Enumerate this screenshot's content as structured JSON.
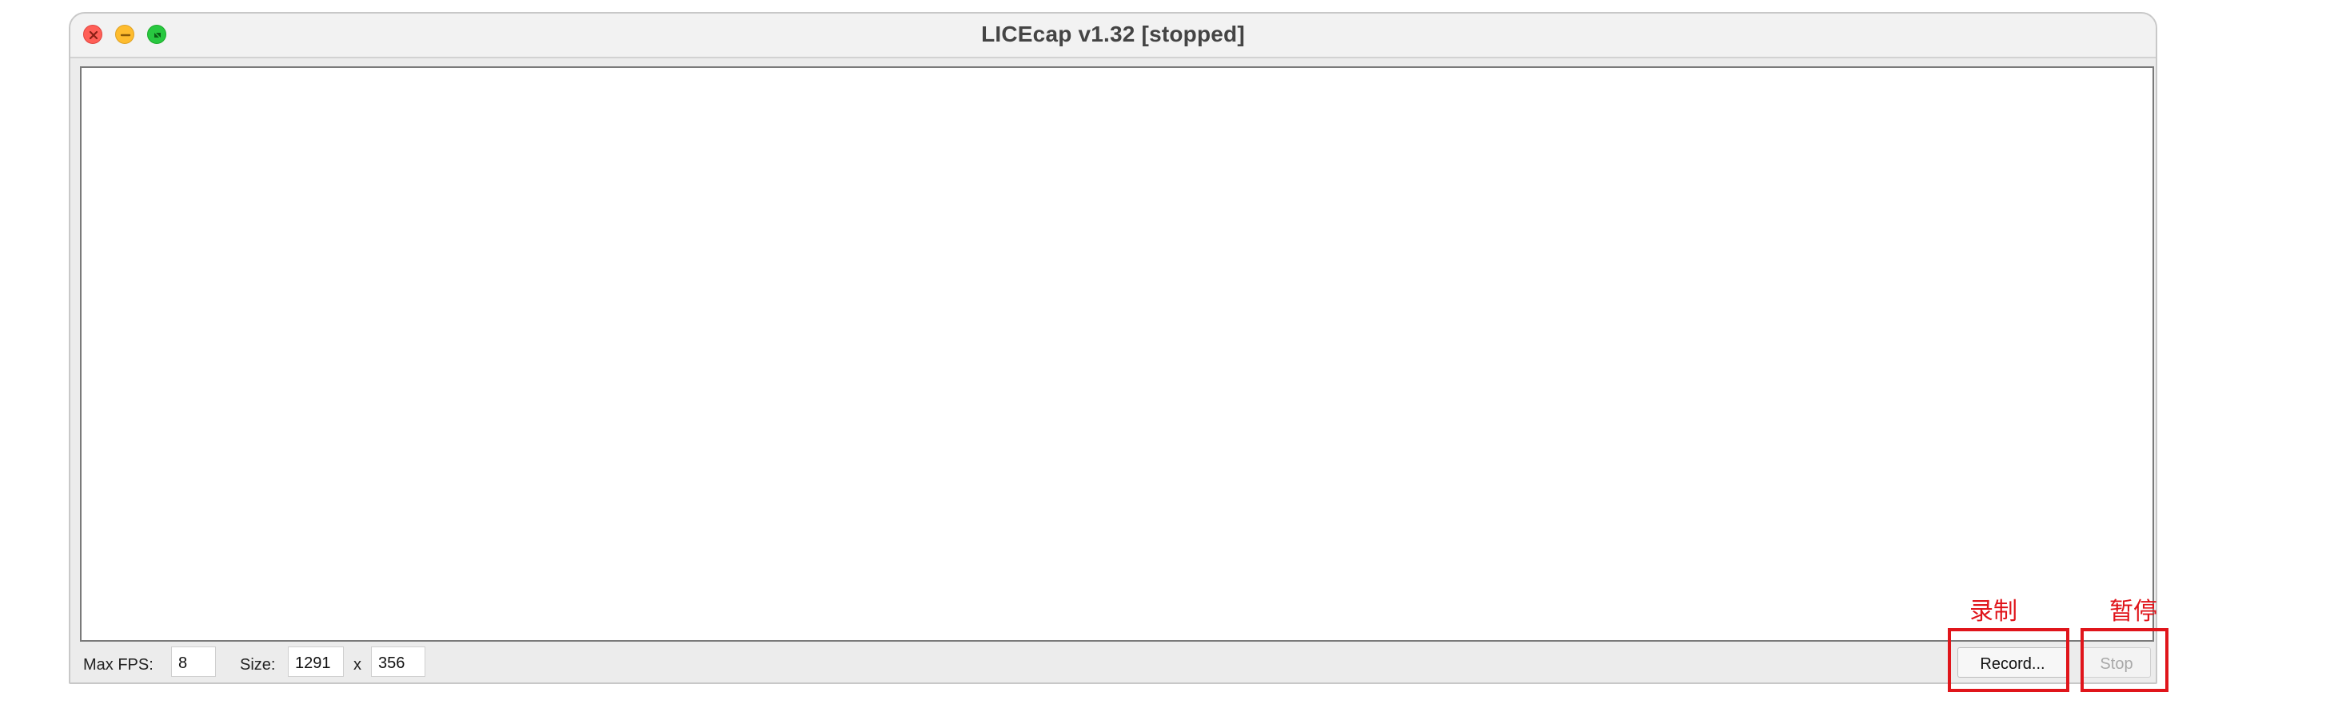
{
  "window": {
    "title": "LICEcap v1.32 [stopped]",
    "controls": {
      "close_icon": "close-icon",
      "minimize_icon": "minimize-icon",
      "maximize_icon": "fullscreen-icon"
    }
  },
  "toolbar": {
    "fps_label": "Max FPS:",
    "fps_value": "8",
    "size_label": "Size:",
    "width_value": "1291",
    "size_separator": "x",
    "height_value": "356",
    "record_label": "Record...",
    "stop_label": "Stop"
  },
  "annotations": {
    "record_note": "录制",
    "stop_note": "暂停",
    "color": "#e0151b"
  }
}
